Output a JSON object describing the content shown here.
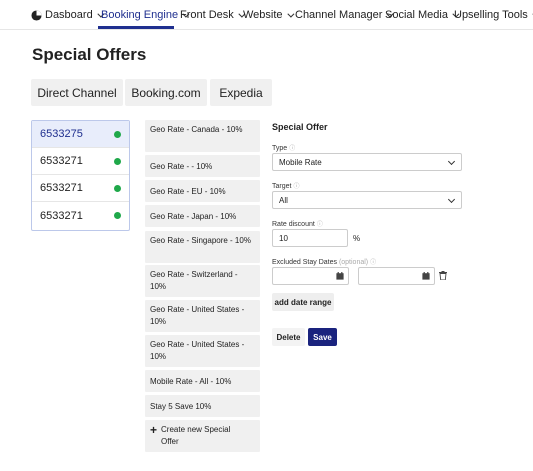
{
  "nav": {
    "items": [
      {
        "label": "Dasboard"
      },
      {
        "label": "Booking Engine"
      },
      {
        "label": "Front Desk"
      },
      {
        "label": "Website"
      },
      {
        "label": "Channel Manager"
      },
      {
        "label": "Social Media"
      },
      {
        "label": "Upselling Tools"
      }
    ],
    "active_color": "#1f2f8f"
  },
  "page": {
    "title": "Special Offers"
  },
  "channels": [
    {
      "label": "Direct Channel"
    },
    {
      "label": "Booking.com"
    },
    {
      "label": "Expedia"
    }
  ],
  "rate_plans": [
    {
      "label": "6533275",
      "status": "active"
    },
    {
      "label": "6533271",
      "status": "active"
    },
    {
      "label": "6533271",
      "status": "active"
    },
    {
      "label": "6533271",
      "status": "active"
    }
  ],
  "offers": [
    {
      "label": "Geo Rate - Canada - 10%"
    },
    {
      "label": "Geo Rate - - 10%"
    },
    {
      "label": "Geo Rate - EU - 10%"
    },
    {
      "label": "Geo Rate - Japan - 10%"
    },
    {
      "label": "Geo Rate - Singapore - 10%"
    },
    {
      "label": "Geo Rate - Switzerland - 10%"
    },
    {
      "label": "Geo Rate - United States - 10%"
    },
    {
      "label": "Geo Rate - United States - 10%"
    },
    {
      "label": "Mobile Rate - All - 10%"
    },
    {
      "label": "Stay 5 Save 10%"
    },
    {
      "label": "Create new Special Offer"
    }
  ],
  "form": {
    "title": "Special Offer",
    "type_label": "Type",
    "type_value": "Mobile Rate",
    "target_label": "Target",
    "target_value": "All",
    "discount_label": "Rate discount",
    "discount_value": "10",
    "discount_unit": "%",
    "excluded_label": "Excluded Stay Dates",
    "excluded_optional": "(optional)",
    "add_range_label": "add date range",
    "delete_label": "Delete",
    "save_label": "Save"
  }
}
